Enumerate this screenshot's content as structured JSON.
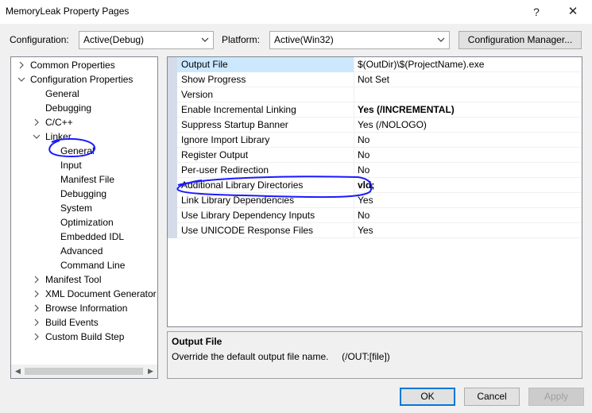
{
  "window": {
    "title": "MemoryLeak Property Pages",
    "help_glyph": "?",
    "close_glyph": "✕"
  },
  "toolbar": {
    "configuration_label": "Configuration:",
    "configuration_value": "Active(Debug)",
    "platform_label": "Platform:",
    "platform_value": "Active(Win32)",
    "config_manager_label": "Configuration Manager..."
  },
  "tree": {
    "common_properties": "Common Properties",
    "configuration_properties": "Configuration Properties",
    "general": "General",
    "debugging": "Debugging",
    "cpp": "C/C++",
    "linker": "Linker",
    "linker_children": [
      "General",
      "Input",
      "Manifest File",
      "Debugging",
      "System",
      "Optimization",
      "Embedded IDL",
      "Advanced",
      "Command Line"
    ],
    "manifest_tool": "Manifest Tool",
    "xml_doc_gen": "XML Document Generator",
    "browse_info": "Browse Information",
    "build_events": "Build Events",
    "custom_build_step": "Custom Build Step"
  },
  "properties": [
    {
      "name": "Output File",
      "value": "$(OutDir)\\$(ProjectName).exe",
      "bold": false
    },
    {
      "name": "Show Progress",
      "value": "Not Set",
      "bold": false
    },
    {
      "name": "Version",
      "value": "",
      "bold": false
    },
    {
      "name": "Enable Incremental Linking",
      "value": "Yes (/INCREMENTAL)",
      "bold": true
    },
    {
      "name": "Suppress Startup Banner",
      "value": "Yes (/NOLOGO)",
      "bold": false
    },
    {
      "name": "Ignore Import Library",
      "value": "No",
      "bold": false
    },
    {
      "name": "Register Output",
      "value": "No",
      "bold": false
    },
    {
      "name": "Per-user Redirection",
      "value": "No",
      "bold": false
    },
    {
      "name": "Additional Library Directories",
      "value": "vld;",
      "bold": true
    },
    {
      "name": "Link Library Dependencies",
      "value": "Yes",
      "bold": false
    },
    {
      "name": "Use Library Dependency Inputs",
      "value": "No",
      "bold": false
    },
    {
      "name": "Use UNICODE Response Files",
      "value": "Yes",
      "bold": false
    }
  ],
  "description": {
    "title": "Output File",
    "text": "Override the default output file name.     (/OUT:[file])"
  },
  "buttons": {
    "ok": "OK",
    "cancel": "Cancel",
    "apply": "Apply"
  },
  "colors": {
    "annotation": "#1a1aff",
    "selection": "#cce8ff",
    "accent": "#0078d7"
  }
}
